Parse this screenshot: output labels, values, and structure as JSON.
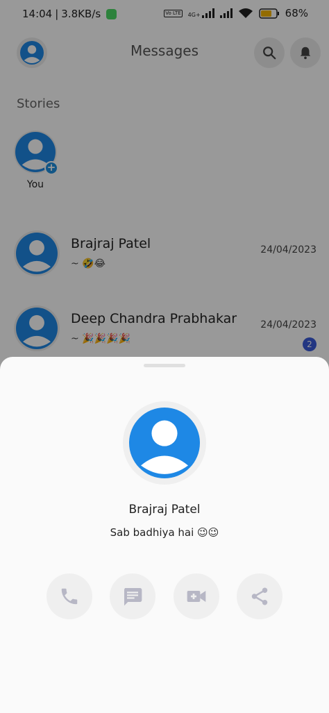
{
  "status_bar": {
    "time": "14:04",
    "speed": "3.8KB/s",
    "network_type": "4G+",
    "volte": "Vo LTE",
    "battery": "68%"
  },
  "header": {
    "title": "Messages"
  },
  "stories": {
    "label": "Stories",
    "items": [
      {
        "name": "You"
      }
    ]
  },
  "chats": [
    {
      "name": "Brajraj Patel",
      "preview": "~ 🤣😂",
      "date": "24/04/2023",
      "unread": ""
    },
    {
      "name": "Deep Chandra Prabhakar",
      "preview": "~ 🎉🎉🎉🎉",
      "date": "24/04/2023",
      "unread": "2"
    }
  ],
  "sheet": {
    "contact_name": "Brajraj Patel",
    "about": "Sab badhiya hai 😉😉",
    "actions": [
      {
        "icon": "phone-icon"
      },
      {
        "icon": "message-icon"
      },
      {
        "icon": "video-call-icon"
      },
      {
        "icon": "share-icon"
      }
    ]
  },
  "colors": {
    "accent_blue": "#1e88e5",
    "badge_blue": "#3a5bd9",
    "icon_grey": "#b7b7c5"
  }
}
